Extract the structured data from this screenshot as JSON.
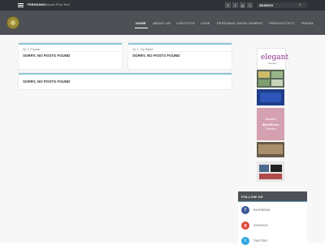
{
  "topbar": {
    "trending_label": "TRENDING:",
    "trending_value": "Sarcah Phot Tere",
    "search_label": "SEARCH",
    "social": [
      {
        "icon": "facebook-icon",
        "glyph": "f"
      },
      {
        "icon": "twitter-icon",
        "glyph": "t"
      },
      {
        "icon": "google-plus-icon",
        "glyph": "g"
      },
      {
        "icon": "rss-icon",
        "glyph": "r"
      }
    ]
  },
  "nav": {
    "items": [
      "HOME",
      "ABOUT US",
      "LIFESTYLE",
      "LOVE",
      "PERSONAL DEVELOPMENT",
      "PRODUCTIVITY",
      "TRAVEL"
    ]
  },
  "boxes": [
    {
      "category": "Ho 1: Popular",
      "title": "SORRY, NO POSTS FOUND"
    },
    {
      "category": "Ho 1: Top Rated",
      "title": "SORRY, NO POSTS FOUND"
    },
    {
      "category": "",
      "title": "SORRY, NO POSTS FOUND"
    }
  ],
  "sidebar": {
    "elegant_text": "elegant",
    "elegant_sub": "themes",
    "wp_line1": "Beautiful",
    "wp_line2": "WordPress",
    "wp_line3": "Themes",
    "follow_title": "FOLLOW US",
    "follow": [
      {
        "label": "FACEBOOK",
        "glyph": "f",
        "color": "#3b5998"
      },
      {
        "label": "GOOGLE+",
        "glyph": "g",
        "color": "#dd4b39"
      },
      {
        "label": "TWITTER",
        "glyph": "t",
        "color": "#2fa8e1"
      }
    ]
  },
  "colors": {
    "topbar": "#2f3236",
    "header": "#4d5054",
    "accent": "#8cc6d4"
  }
}
